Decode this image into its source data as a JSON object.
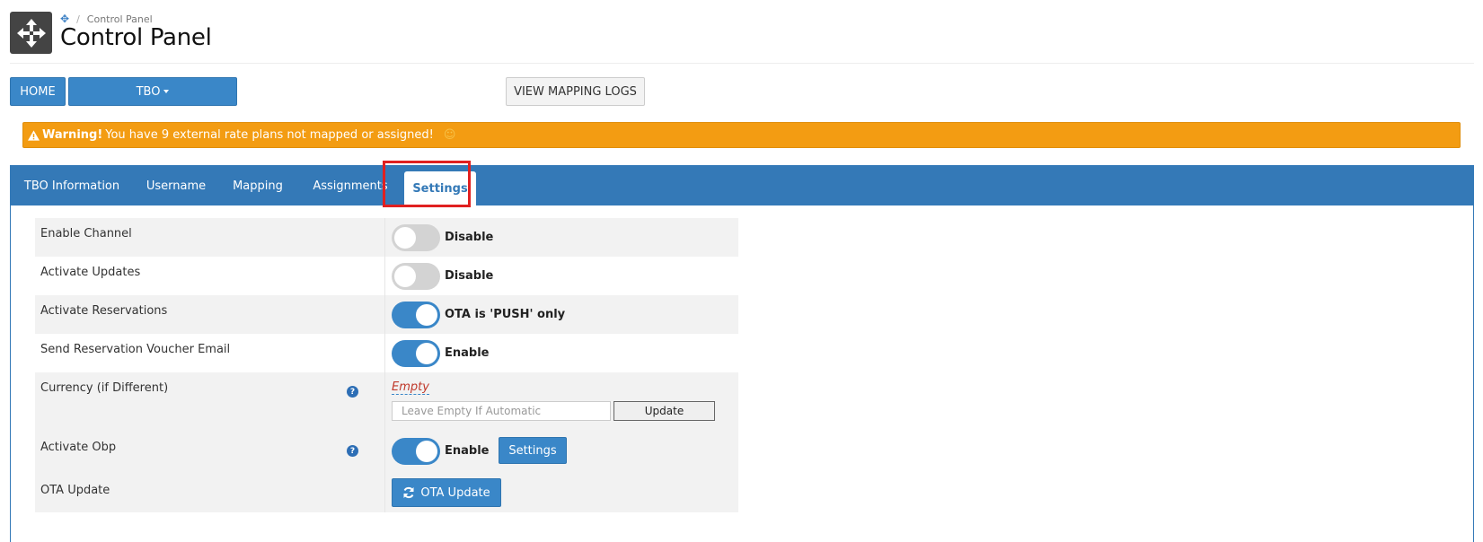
{
  "header": {
    "breadcrumb": "Control Panel",
    "title": "Control Panel"
  },
  "toolbar": {
    "home_label": "HOME",
    "tbo_label": "TBO",
    "logs_label": "VIEW MAPPING LOGS"
  },
  "warning": {
    "strong": "Warning!",
    "message": "You have 9 external rate plans not mapped or assigned!"
  },
  "tabs": [
    {
      "label": "TBO Information"
    },
    {
      "label": "Username"
    },
    {
      "label": "Mapping"
    },
    {
      "label": "Assignments"
    },
    {
      "label": "Settings",
      "active": true
    }
  ],
  "settings": {
    "enable_channel": {
      "label": "Enable Channel",
      "state": "Disable"
    },
    "activate_updates": {
      "label": "Activate Updates",
      "state": "Disable"
    },
    "activate_reservations": {
      "label": "Activate Reservations",
      "state": "OTA is 'PUSH' only"
    },
    "send_voucher": {
      "label": "Send Reservation Voucher Email",
      "state": "Enable"
    },
    "currency": {
      "label": "Currency (if Different)",
      "empty_text": "Empty",
      "placeholder": "Leave Empty If Automatic",
      "update_label": "Update"
    },
    "activate_obp": {
      "label": "Activate Obp",
      "state": "Enable",
      "settings_label": "Settings"
    },
    "ota_update": {
      "label": "OTA Update",
      "button_label": "OTA Update"
    }
  },
  "icons": {
    "logo": "move-arrows-icon",
    "breadcrumb": "move-arrows-icon",
    "warning": "warning-triangle-icon",
    "smile": "smile-icon",
    "help": "question-circle-icon",
    "refresh": "refresh-icon"
  },
  "colors": {
    "primary": "#3a87c8",
    "tabbar": "#3479b7",
    "warning": "#f39c12",
    "highlight": "#e02020"
  }
}
